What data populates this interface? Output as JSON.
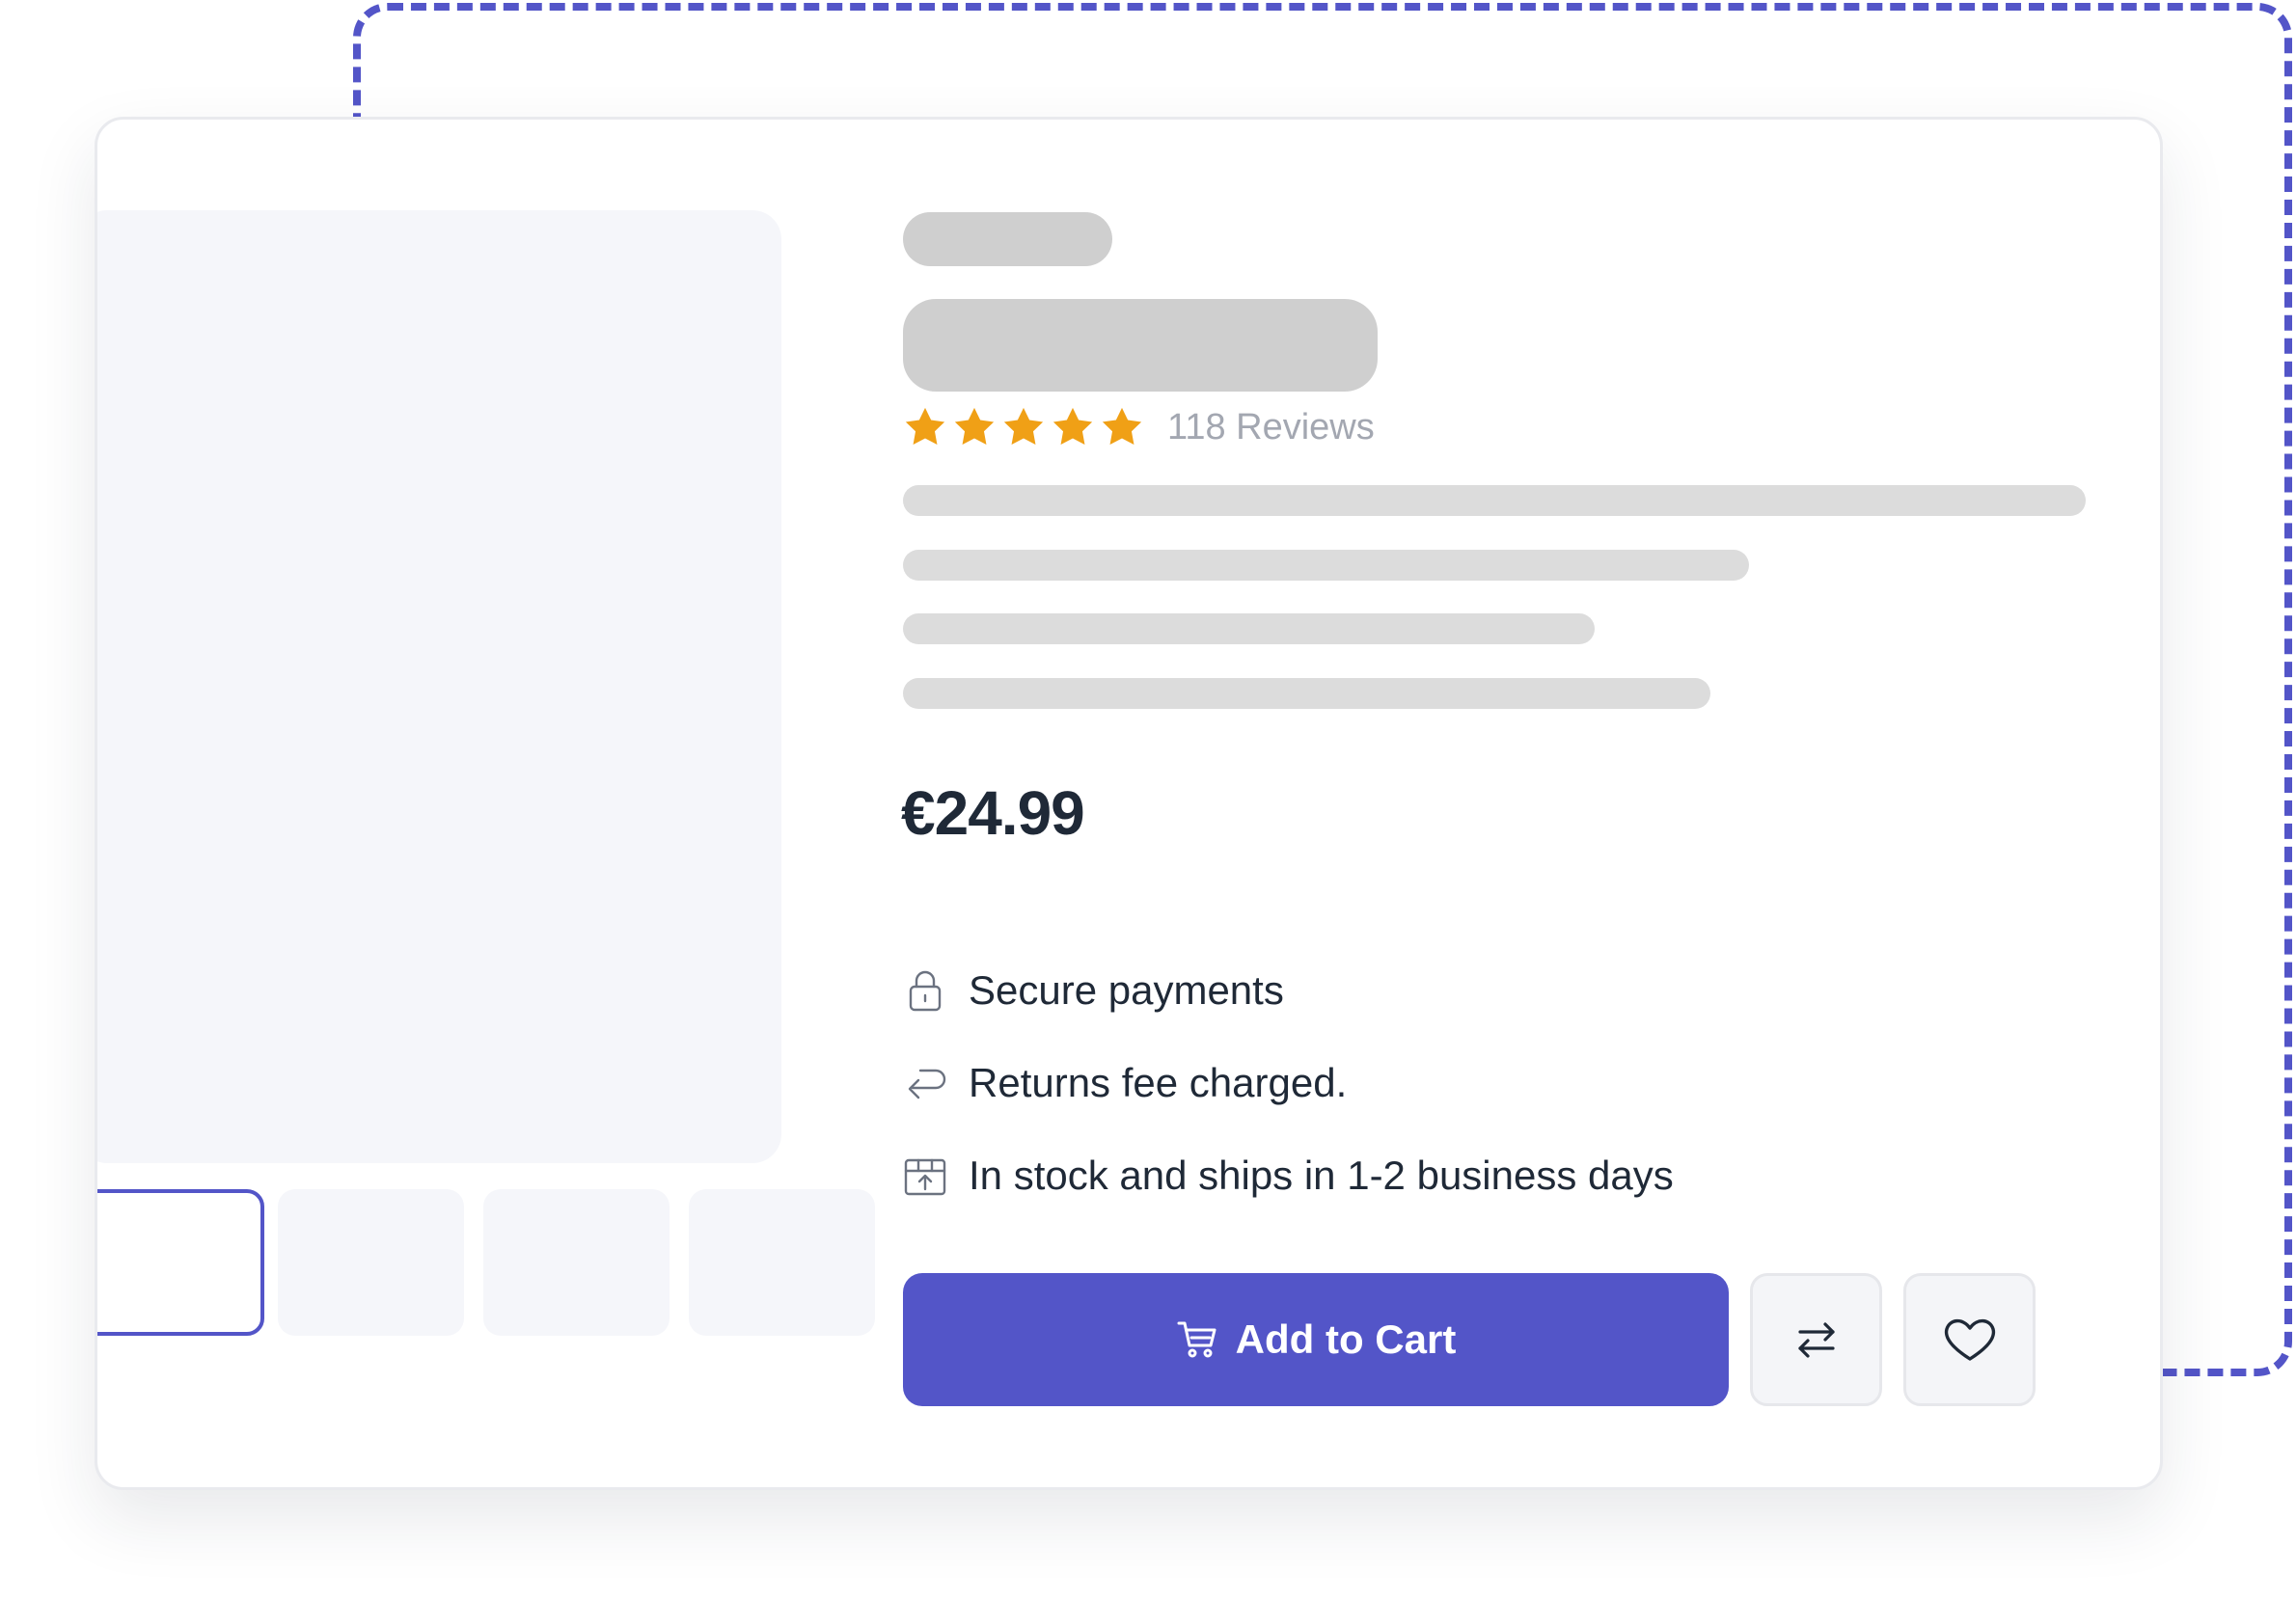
{
  "product": {
    "rating_stars": 5,
    "reviews_text": "118 Reviews",
    "price": "€24.99"
  },
  "features": [
    {
      "icon": "lock-icon",
      "text": "Secure payments"
    },
    {
      "icon": "return-arrow-icon",
      "text": "Returns fee charged."
    },
    {
      "icon": "box-upload-icon",
      "text": "In stock and ships in 1-2 business days"
    }
  ],
  "actions": {
    "add_to_cart_label": "Add to Cart",
    "compare_icon": "swap-arrows-icon",
    "wishlist_icon": "heart-icon"
  },
  "colors": {
    "accent": "#5355c8",
    "star": "#f0a016",
    "text": "#1f2937",
    "muted": "#a3a7b1",
    "skeleton": "#cfcfcf"
  }
}
